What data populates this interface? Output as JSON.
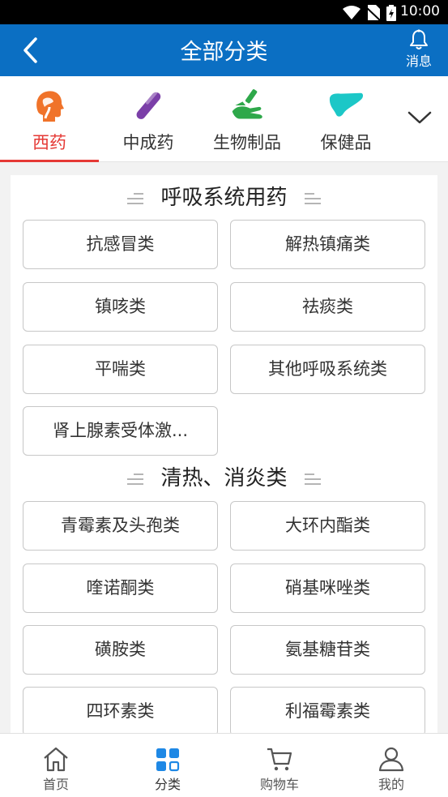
{
  "status_bar": {
    "time": "10:00"
  },
  "header": {
    "title": "全部分类",
    "message_label": "消息"
  },
  "category_tabs": [
    {
      "label": "西药",
      "active": true,
      "icon": "head-icon",
      "color": "#f0732a"
    },
    {
      "label": "中成药",
      "active": false,
      "icon": "capsule-icon",
      "color": "#7b3fa8"
    },
    {
      "label": "生物制品",
      "active": false,
      "icon": "hand-syringe-icon",
      "color": "#2ea84a"
    },
    {
      "label": "保健品",
      "active": false,
      "icon": "liver-icon",
      "color": "#1cc7c7"
    }
  ],
  "sections": [
    {
      "title": "呼吸系统用药",
      "items": [
        "抗感冒类",
        "解热镇痛类",
        "镇咳类",
        "祛痰类",
        "平喘类",
        "其他呼吸系统类",
        "肾上腺素受体激..."
      ]
    },
    {
      "title": "清热、消炎类",
      "items": [
        "青霉素及头孢类",
        "大环内酯类",
        "喹诺酮类",
        "硝基咪唑类",
        "磺胺类",
        "氨基糖苷类",
        "四环素类",
        "利福霉素类"
      ]
    }
  ],
  "bottom_nav": [
    {
      "label": "首页",
      "icon": "home-icon",
      "active": false
    },
    {
      "label": "分类",
      "icon": "category-grid-icon",
      "active": true
    },
    {
      "label": "购物车",
      "icon": "cart-icon",
      "active": false
    },
    {
      "label": "我的",
      "icon": "user-icon",
      "active": false
    }
  ],
  "colors": {
    "header_bg": "#0b6fc3",
    "active_tab": "#e53935",
    "active_nav": "#1e88e5"
  }
}
